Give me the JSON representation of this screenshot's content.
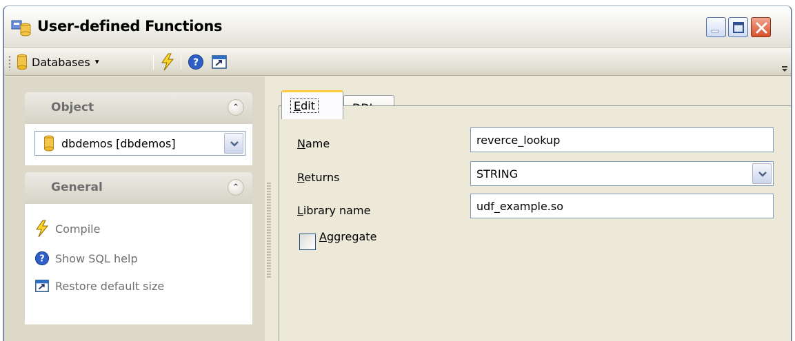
{
  "window": {
    "title": "User-defined Functions",
    "icon": "user-defined-functions-icon"
  },
  "toolbar": {
    "databases_label": "Databases",
    "icons": [
      "database-icon",
      "lightning-compile-icon",
      "help-icon",
      "restore-size-icon"
    ]
  },
  "sidebar": {
    "object_group": {
      "title": "Object",
      "database_value": "dbdemos [dbdemos]"
    },
    "general_group": {
      "title": "General",
      "tasks": [
        {
          "label": "Compile",
          "icon": "lightning-compile-icon"
        },
        {
          "label": "Show SQL help",
          "icon": "help-icon"
        },
        {
          "label": "Restore default size",
          "icon": "restore-size-icon"
        }
      ]
    }
  },
  "tabs": {
    "edit": {
      "label_access": "E",
      "label_rest": "dit"
    },
    "ddl": {
      "label_pre": "DD",
      "label_access": "L"
    }
  },
  "form": {
    "name": {
      "label_access": "N",
      "label_rest": "ame",
      "value": "reverce_lookup"
    },
    "returns": {
      "label_access": "R",
      "label_rest": "eturns",
      "value": "STRING"
    },
    "library_name": {
      "label_access": "L",
      "label_rest": "ibrary name",
      "value": "udf_example.so"
    },
    "aggregate": {
      "label_access": "A",
      "label_rest": "ggregate",
      "checked": false
    }
  },
  "colors": {
    "window_bg": "#ece9d8",
    "sidebar_bg": "#dcd9cb",
    "active_tab_accent": "#ffc83c",
    "close_button": "#d4512d",
    "input_border": "#7f9db9"
  }
}
